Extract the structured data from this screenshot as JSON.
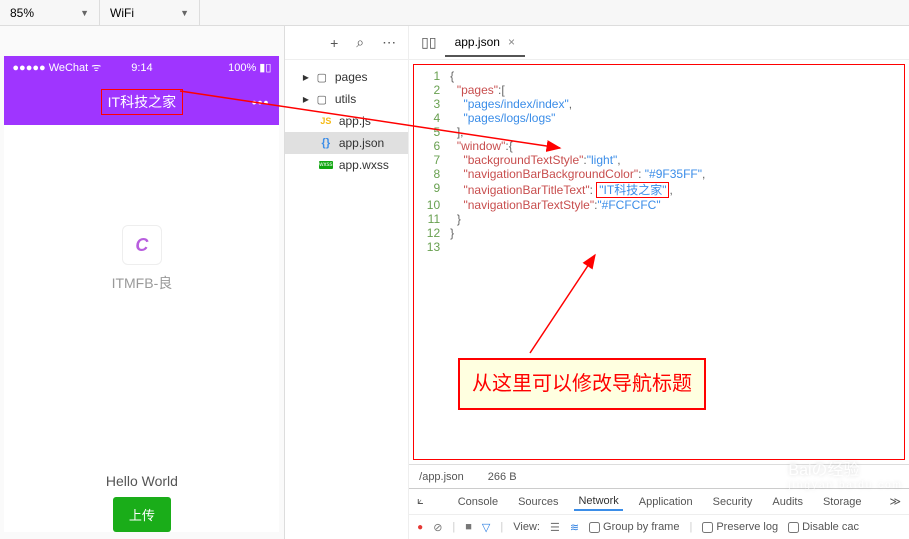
{
  "toolbar": {
    "zoom": "85%",
    "network": "WiFi"
  },
  "simulator": {
    "status": {
      "left": "WeChat",
      "time": "9:14",
      "right": "100%"
    },
    "nav_title": "IT科技之家",
    "logo_letter": "C",
    "logo_caption": "ITMFB-良",
    "hello": "Hello World",
    "upload": "上传"
  },
  "tree": {
    "pages": "pages",
    "utils": "utils",
    "appjs": "app.js",
    "appjson": "app.json",
    "appwxss": "app.wxss"
  },
  "tab": {
    "name": "app.json"
  },
  "code": {
    "l1": "{",
    "l2a": "\"pages\"",
    "l2b": ":[",
    "l3": "\"pages/index/index\"",
    "l3b": ",",
    "l4": "\"pages/logs/logs\"",
    "l5": "],",
    "l6a": "\"window\"",
    "l6b": ":{",
    "l7a": "\"backgroundTextStyle\"",
    "l7b": "\"light\"",
    "l8a": "\"navigationBarBackgroundColor\"",
    "l8b": "\"#9F35FF\"",
    "l9a": "\"navigationBarTitleText\"",
    "l9b": "\"IT科技之家\"",
    "l10a": "\"navigationBarTextStyle\"",
    "l10b": "\"#FCFCFC\"",
    "l11": "}",
    "l12": "}"
  },
  "annotation": "从这里可以修改导航标题",
  "status": {
    "path": "/app.json",
    "size": "266 B"
  },
  "devtools": {
    "tabs": [
      "Console",
      "Sources",
      "Network",
      "Application",
      "Security",
      "Audits",
      "Storage"
    ],
    "view": "View:",
    "group": "Group by frame",
    "preserve": "Preserve log",
    "disable": "Disable cac"
  },
  "watermark": {
    "main": "Baiの经验",
    "sub": "jingyan.baidu.com"
  }
}
